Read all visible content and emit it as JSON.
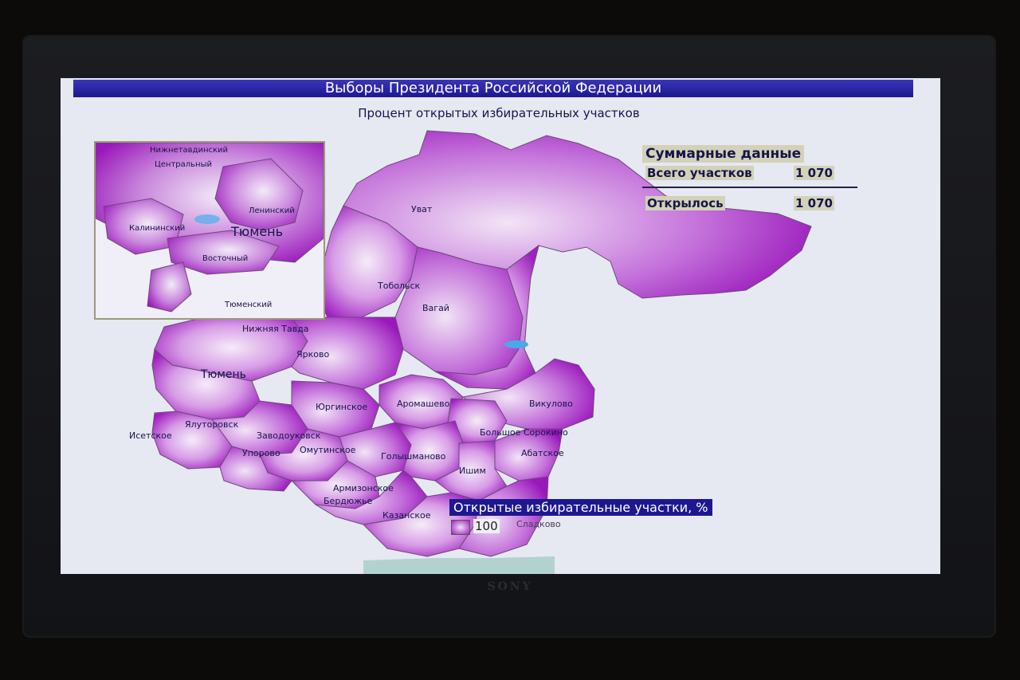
{
  "header": {
    "title": "Выборы Президента Российской Федерации",
    "subtitle": "Процент открытых избирательных участков"
  },
  "summary": {
    "title": "Суммарные данные",
    "total_label": "Всего участков",
    "total_value": "1 070",
    "opened_label": "Открылось",
    "opened_value": "1 070"
  },
  "legend": {
    "title": "Открытые избирательные участки, %",
    "value": "100"
  },
  "inset_labels": {
    "nizhnetavdinsky": "Нижнетавдинский",
    "tsentralny": "Центральный",
    "leninsky": "Ленинский",
    "kalininsky": "Калининский",
    "tyumen": "Тюмень",
    "vostochny": "Восточный",
    "tyumensky": "Тюменский"
  },
  "map_labels": {
    "uvat": "Уват",
    "tobolsk": "Тобольск",
    "vagai": "Вагай",
    "nizhnyaya_tavda": "Нижняя Тавда",
    "yarkovo": "Ярково",
    "tyumen": "Тюмень",
    "yurginskoe": "Юргинское",
    "aromashevo": "Аромашево",
    "vikulovo": "Викулово",
    "yalutorovsk": "Ялуторовск",
    "isetskoe": "Исетское",
    "zavodoukovsk": "Заводоуковск",
    "bolshoe_sorokino": "Большое Сорокино",
    "omutinskoe": "Омутинское",
    "uporovo": "Упорово",
    "golyshmanovo": "Голышманово",
    "abatskoe": "Абатское",
    "ishim": "Ишим",
    "armizonskoe": "Армизонское",
    "berdyuzhye": "Бердюжье",
    "kazanskoe": "Казанское",
    "sladkovo": "Сладково"
  },
  "colors": {
    "region_fill_dark": "#a020c0",
    "region_fill_light": "#f3e6f6",
    "title_bar": "#1d1890",
    "lake": "#4aa8e8"
  },
  "device": {
    "brand": "SONY"
  }
}
